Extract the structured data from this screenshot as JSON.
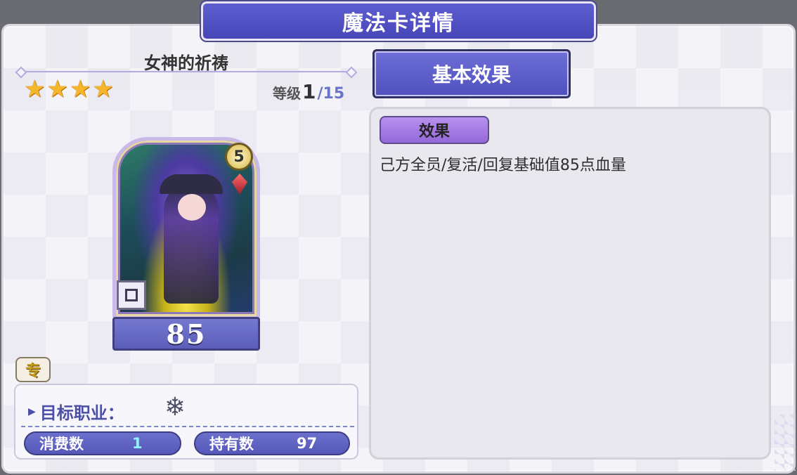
{
  "header": {
    "title": "魔法卡详情"
  },
  "card": {
    "name": "女神的祈祷",
    "stars": 4,
    "level_label": "等级",
    "level_current": "1",
    "level_max": "/15",
    "cost_badge": "5",
    "value": "85"
  },
  "exclusive_tag": "专",
  "job": {
    "label": "目标职业：",
    "icon": "compass-snowflake-icon"
  },
  "stats": {
    "consume_label": "消费数",
    "consume_value": "1",
    "own_label": "持有数",
    "own_value": "97"
  },
  "effect": {
    "tab_label": "基本效果",
    "chip_label": "效果",
    "description": "己方全员/复活/回复基础值85点血量"
  },
  "colors": {
    "accent": "#5050be",
    "star": "#f6b629",
    "consume_value": "#8ef3ff"
  }
}
